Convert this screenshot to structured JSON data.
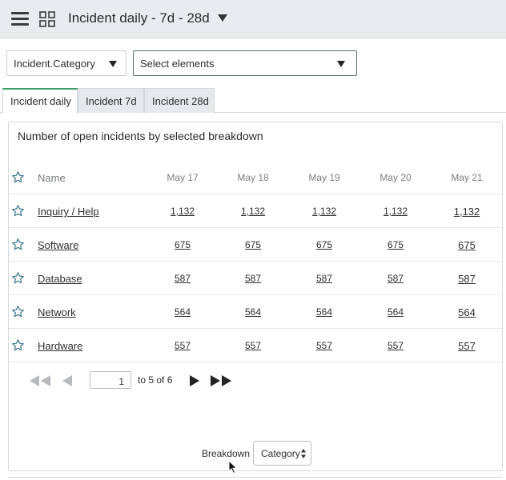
{
  "header": {
    "title": "Incident daily - 7d - 28d",
    "menu_icon": "hamburger-icon",
    "grid_icon": "grid-icon"
  },
  "filters": {
    "category_value": "Incident.Category",
    "elements_placeholder": "Select elements"
  },
  "tabs": [
    {
      "label": "Incident daily",
      "active": true
    },
    {
      "label": "Incident 7d",
      "active": false
    },
    {
      "label": "Incident 28d",
      "active": false
    }
  ],
  "table": {
    "title": "Number of open incidents by selected breakdown",
    "columns": [
      "Name",
      "May 17",
      "May 18",
      "May 19",
      "May 20",
      "May 21"
    ],
    "rows": [
      {
        "name": "Inquiry / Help",
        "values": [
          "1,132",
          "1,132",
          "1,132",
          "1,132",
          "1,132"
        ]
      },
      {
        "name": "Software",
        "values": [
          "675",
          "675",
          "675",
          "675",
          "675"
        ]
      },
      {
        "name": "Database",
        "values": [
          "587",
          "587",
          "587",
          "587",
          "587"
        ]
      },
      {
        "name": "Network",
        "values": [
          "564",
          "564",
          "564",
          "564",
          "564"
        ]
      },
      {
        "name": "Hardware",
        "values": [
          "557",
          "557",
          "557",
          "557",
          "557"
        ]
      }
    ]
  },
  "pagination": {
    "page": "1",
    "range_text": "to 5 of 6"
  },
  "breakdown": {
    "label": "Breakdown",
    "value": "Category"
  },
  "colors": {
    "active_tab_accent": "#3f9d6a",
    "star_outline": "#2f6f86",
    "header_bg": "#e9ebee"
  }
}
